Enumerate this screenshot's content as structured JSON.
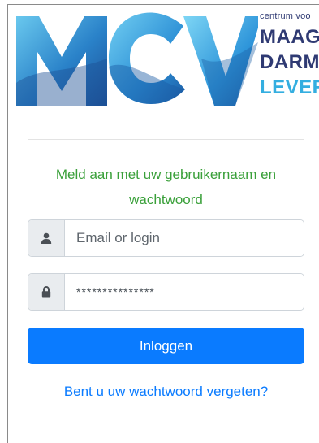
{
  "logo": {
    "letters": "MCV",
    "small": "centrum voo",
    "line1": "MAAG",
    "line2": "DARM",
    "line3": "LEVER"
  },
  "intro": {
    "line1": "Meld aan met uw gebruikernaam en",
    "line2": "wachtwoord"
  },
  "login": {
    "email_placeholder": "Email or login",
    "password_value": "***************",
    "submit_label": "Inloggen",
    "forgot_link": "Bent u uw wachtwoord vergeten?"
  },
  "colors": {
    "primary": "#0a7bff",
    "intro_text": "#3aa03a",
    "brand_dark": "#2f3a73",
    "brand_light": "#34aee0"
  },
  "icons": {
    "user": "user-icon",
    "lock": "lock-icon"
  }
}
